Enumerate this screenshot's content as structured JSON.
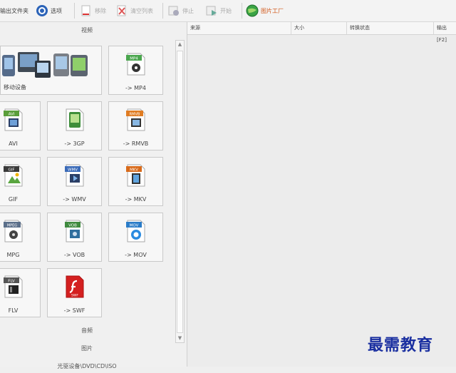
{
  "toolbar": {
    "output_folder": "输出文件夹",
    "options": "选项",
    "remove": "移除",
    "clear_list": "清空列表",
    "stop": "停止",
    "start": "开始",
    "image_factory": "图片工厂"
  },
  "left": {
    "video_header": "视频",
    "tiles": {
      "mobile": "移动设备",
      "mp4": "-> MP4",
      "avi": "AVI",
      "3gp": "-> 3GP",
      "rmvb": "-> RMVB",
      "gif": "GIF",
      "wmv": "-> WMV",
      "mkv": "-> MKV",
      "mpg": "MPG",
      "vob": "-> VOB",
      "mov": "-> MOV",
      "flv": "FLV",
      "swf": "-> SWF"
    },
    "badges": {
      "mp4": "MP4",
      "avi": "AVI",
      "rmvb": "RMVB",
      "gif": "GIF",
      "wmv": "WMV",
      "mkv": "MKV",
      "mpg": "MPEG",
      "vob": "VOB",
      "mov": "MOV",
      "flv": "FLV",
      "swf": "SWF"
    },
    "audio_header": "音频",
    "image_header": "图片",
    "rom_header": "光驱设备\\DVD\\CD\\ISO"
  },
  "table": {
    "columns": [
      "来源",
      "大小",
      "转换状态",
      "输出 [F2]"
    ]
  },
  "watermark": "最需教育"
}
